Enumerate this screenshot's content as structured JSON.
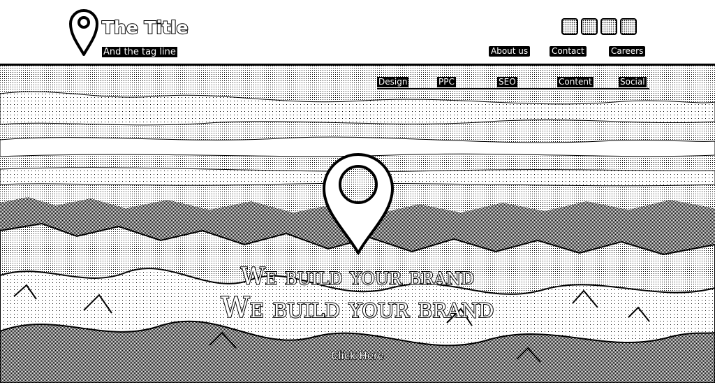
{
  "brand": {
    "title": "The Title",
    "tagline": "And the tag line",
    "logo_icon": "map-pin-icon"
  },
  "social_icons": [
    {
      "icon": "social-icon-1"
    },
    {
      "icon": "social-icon-2"
    },
    {
      "icon": "social-icon-3"
    },
    {
      "icon": "social-icon-4"
    }
  ],
  "top_nav": {
    "items": [
      {
        "label": "About us"
      },
      {
        "label": "Contact"
      },
      {
        "label": "Careers"
      }
    ]
  },
  "sub_nav": {
    "items": [
      {
        "label": "Design"
      },
      {
        "label": "PPC"
      },
      {
        "label": "SEO"
      },
      {
        "label": "Content"
      },
      {
        "label": "Social"
      }
    ]
  },
  "hero": {
    "icon": "map-pin-icon",
    "headline_1": "We build your brand",
    "headline_2": "We build your brand",
    "cta_label": "Click Here"
  },
  "colors": {
    "ink": "#000000",
    "paper": "#ffffff"
  }
}
